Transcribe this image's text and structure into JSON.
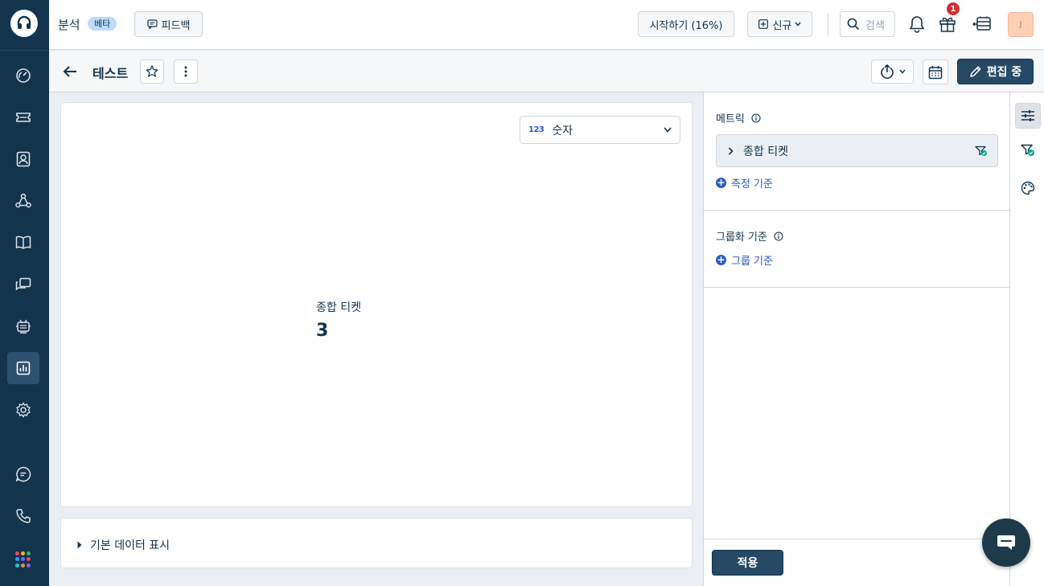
{
  "app": {
    "title": "분석",
    "beta_badge": "베타",
    "feedback_label": "피드백"
  },
  "topbar": {
    "getting_started_label": "시작하기 (16%)",
    "new_label": "신규",
    "search_placeholder": "검색",
    "notification_badge_count": "1",
    "avatar_initial": "J"
  },
  "subheader": {
    "page_title": "테스트",
    "editing_label": "편집 중"
  },
  "visualization": {
    "type_icon_text": "123",
    "type_label": "숫자"
  },
  "metric_display": {
    "label": "종합 티켓",
    "value": "3"
  },
  "underlying_data": {
    "toggle_label": "기본 데이터 표시"
  },
  "right_panel": {
    "metrics_title": "메트릭",
    "metric_item_label": "종합 티켓",
    "add_measure_label": "측정 기준",
    "group_by_title": "그룹화 기준",
    "add_group_label": "그룹 기준",
    "apply_label": "적용"
  },
  "colors": {
    "sidebar_bg": "#12344d",
    "primary_button": "#264966",
    "link_blue": "#2c5cc5",
    "badge_red": "#d72d30",
    "beta_bg": "#bbdcfe",
    "app_grid": [
      "#f3436c",
      "#ffb400",
      "#31b65e",
      "#2c9cf5",
      "#7f61f2",
      "#f3436c",
      "#2cc5c5",
      "#ff8b2d",
      "#9b59f5"
    ]
  }
}
